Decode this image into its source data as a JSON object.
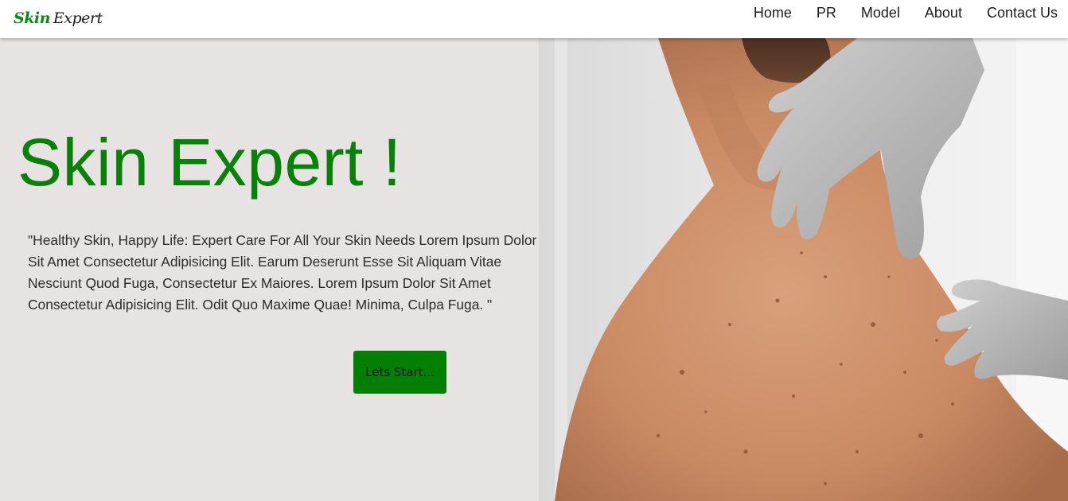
{
  "brand": {
    "name_part1": "Skin",
    "name_part2": "Expert"
  },
  "nav": {
    "items": [
      "Home",
      "PR",
      "Model",
      "About",
      "Contact Us"
    ]
  },
  "hero": {
    "title": "Skin Expert !",
    "text": "\"Healthy Skin, Happy Life: Expert Care For All Your Skin Needs Lorem Ipsum Dolor Sit Amet Consectetur Adipisicing Elit. Earum Deserunt Esse Sit Aliquam Vitae Nesciunt Quod Fuga, Consectetur Ex Maiores. Lorem Ipsum Dolor Sit Amet Consectetur Adipisicing Elit. Odit Quo Maxime Quae! Minima, Culpa Fuga. \"",
    "button_label": "Lets Start..."
  },
  "colors": {
    "accent": "#078107",
    "button": "#038003",
    "hero_background": "#e8e3e3"
  }
}
